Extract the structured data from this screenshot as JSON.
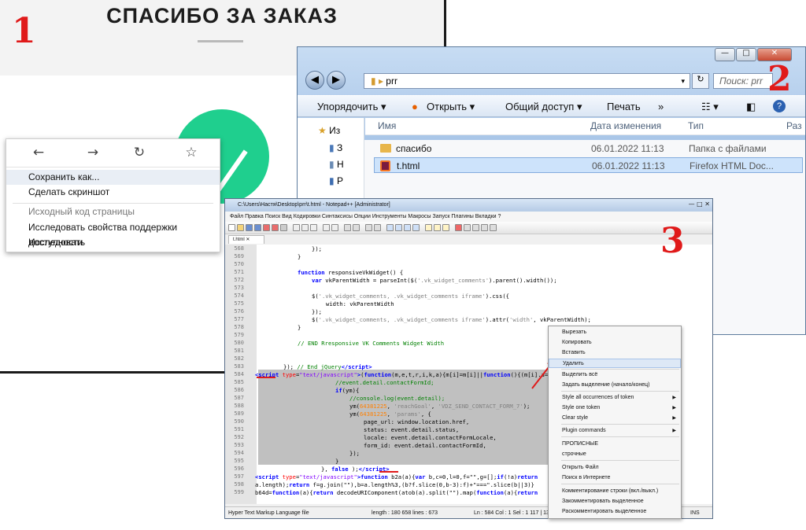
{
  "panel1": {
    "title": "СПАСИБО ЗА ЗАКАЗ",
    "label": "1",
    "nav": [
      "←",
      "→",
      "↻",
      "☆"
    ],
    "menu": [
      "Сохранить как...",
      "Сделать скриншот",
      "Исходный код страницы",
      "Исследовать свойства поддержки доступности",
      "Исследовать"
    ]
  },
  "panel2": {
    "label": "2",
    "address": "prr",
    "search_placeholder": "Поиск: prr",
    "commands": [
      "Упорядочить ▾",
      "Открыть ▾",
      "Общий доступ ▾",
      "Печать",
      "»"
    ],
    "nav_items": [
      "Из",
      "З",
      "Н",
      "Р"
    ],
    "columns": [
      "Имя",
      "Дата изменения",
      "Тип",
      "Раз"
    ],
    "files": [
      {
        "name": "спасибо",
        "date": "06.01.2022 11:13",
        "type": "Папка с файлами"
      },
      {
        "name": "t.html",
        "date": "06.01.2022 11:13",
        "type": "Firefox HTML Doc..."
      }
    ]
  },
  "panel3": {
    "label": "3",
    "title": "C:\\Users\\Настя\\Desktop\\prr\\t.html - Notepad++ [Administrator]",
    "menu": "Файл  Правка  Поиск  Вид  Кодировки  Синтаксисы  Опции  Инструменты  Макросы  Запуск  Плагины  Вкладки  ?",
    "tab": "t.html ✕",
    "lines": [
      "568",
      "569",
      "570",
      "571",
      "572",
      "573",
      "574",
      "575",
      "576",
      "577",
      "578",
      "579",
      "580",
      "581",
      "582",
      "583",
      "584",
      "585",
      "586",
      "587",
      "588",
      "589",
      "590",
      "591",
      "592",
      "593",
      "594",
      "595",
      "596",
      "597",
      "598",
      "599"
    ],
    "status": {
      "type": "Hyper Text Markup Language file",
      "length": "length : 180 658    lines : 673",
      "pos": "Ln : 584    Col : 1    Sel : 1 117 | 13",
      "ins": "INS"
    },
    "context_menu": [
      "Вырезать",
      "Копировать",
      "Вставить",
      "Удалить",
      "Выделить всё",
      "Задать выделение (начало/конец)",
      "Style all occurrences of token",
      "Style one token",
      "Clear style",
      "Plugin commands",
      "ПРОПИСНЫЕ",
      "строчные",
      "Открыть Файл",
      "Поиск в Интернете",
      "Комментирование строки (вкл./выкл.)",
      "Закомментировать выделенное",
      "Раскомментировать выделенное"
    ]
  }
}
